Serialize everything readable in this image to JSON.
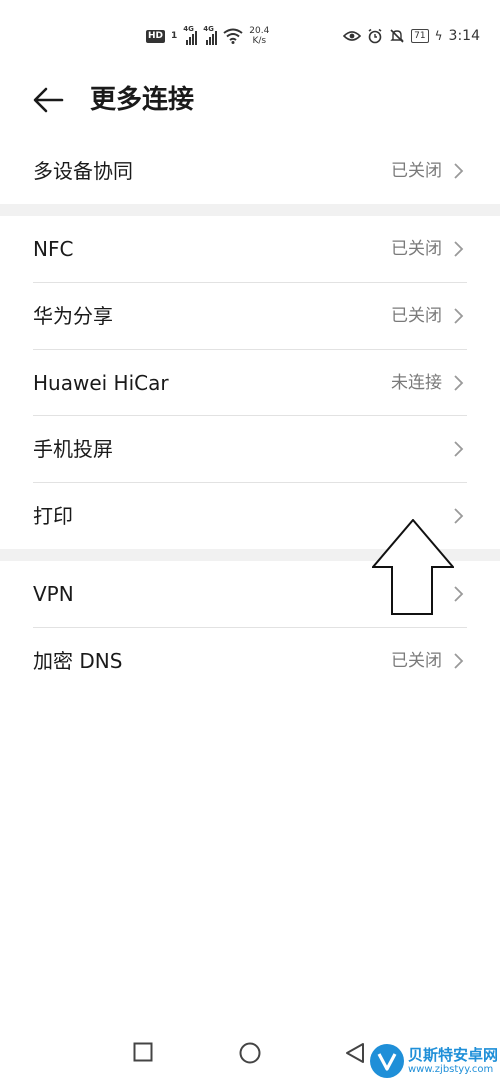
{
  "status_bar": {
    "hd": "HD",
    "sim1": "1",
    "net1": "4G",
    "net2": "4G",
    "speed_value": "20.4",
    "speed_unit": "K/s",
    "battery": "71",
    "time": "3:14"
  },
  "header": {
    "title": "更多连接"
  },
  "rows": [
    {
      "label": "多设备协同",
      "value": "已关闭"
    },
    {
      "label": "NFC",
      "value": "已关闭"
    },
    {
      "label": "华为分享",
      "value": "已关闭"
    },
    {
      "label": "Huawei HiCar",
      "value": "未连接"
    },
    {
      "label": "手机投屏",
      "value": ""
    },
    {
      "label": "打印",
      "value": ""
    },
    {
      "label": "VPN",
      "value": ""
    },
    {
      "label": "加密 DNS",
      "value": "已关闭"
    }
  ],
  "watermark": {
    "name": "贝斯特安卓网",
    "url": "www.zjbstyy.com"
  },
  "colors": {
    "accent": "#1f8fd8",
    "secondary_text": "#7a7a7a",
    "divider": "#e2e2e2",
    "section_gap": "#f1f1f1"
  }
}
